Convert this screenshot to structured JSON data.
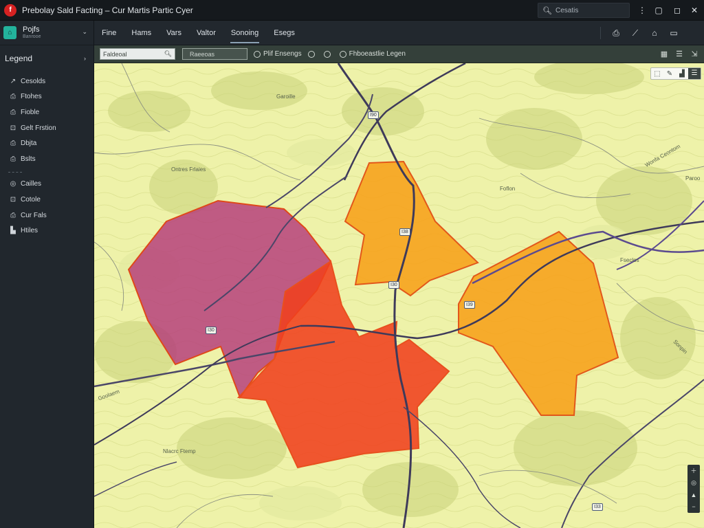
{
  "window": {
    "title": "Prebolay Sald Facting – Cur Martis Partic Cyer",
    "search_placeholder": "Cesatis"
  },
  "project": {
    "name": "Pojfs",
    "sub": "Banrooe"
  },
  "legend": {
    "title": "Legend",
    "items": [
      {
        "icon": "↗",
        "label": "Cesolds"
      },
      {
        "icon": "⎙",
        "label": "Ftohes"
      },
      {
        "icon": "⎙",
        "label": "Fioble"
      },
      {
        "icon": "⊡",
        "label": "Gelt Frstion"
      },
      {
        "icon": "⎙",
        "label": "Dbjta"
      },
      {
        "icon": "⎙",
        "label": "Bslts"
      }
    ],
    "items2": [
      {
        "icon": "◎",
        "label": "Cailles"
      },
      {
        "icon": "⊡",
        "label": "Cotole"
      },
      {
        "icon": "⎙",
        "label": "Cur Fals"
      },
      {
        "icon": "▙",
        "label": "Htiles"
      }
    ]
  },
  "menu": {
    "items": [
      "Fine",
      "Hams",
      "Vars",
      "Valtor",
      "Sonoing",
      "Esegs"
    ],
    "active_index": 4
  },
  "map_toolbar": {
    "search_value": "Faldeoal",
    "filter_value": "Raeeoas",
    "btn1": "Plif Ensengs",
    "btn2": "Fhboeastlie Legen"
  },
  "map": {
    "road_labels": [
      "I90",
      "I38",
      "I30",
      "I39",
      "I30",
      "I33"
    ],
    "place_labels": [
      "Garoille",
      "Ontres Frlaies",
      "Foflon",
      "Wonfa Ceontom",
      "Fseclos",
      "Paroo",
      "Goolaem",
      "Sonpin",
      "Nlacrc Ftemp"
    ],
    "zones": [
      {
        "name": "zone-purple",
        "color": "#b5397a"
      },
      {
        "name": "zone-red",
        "color": "#f0401e"
      },
      {
        "name": "zone-orange-north",
        "color": "#f7a019"
      },
      {
        "name": "zone-orange-east",
        "color": "#f7a019"
      }
    ]
  }
}
